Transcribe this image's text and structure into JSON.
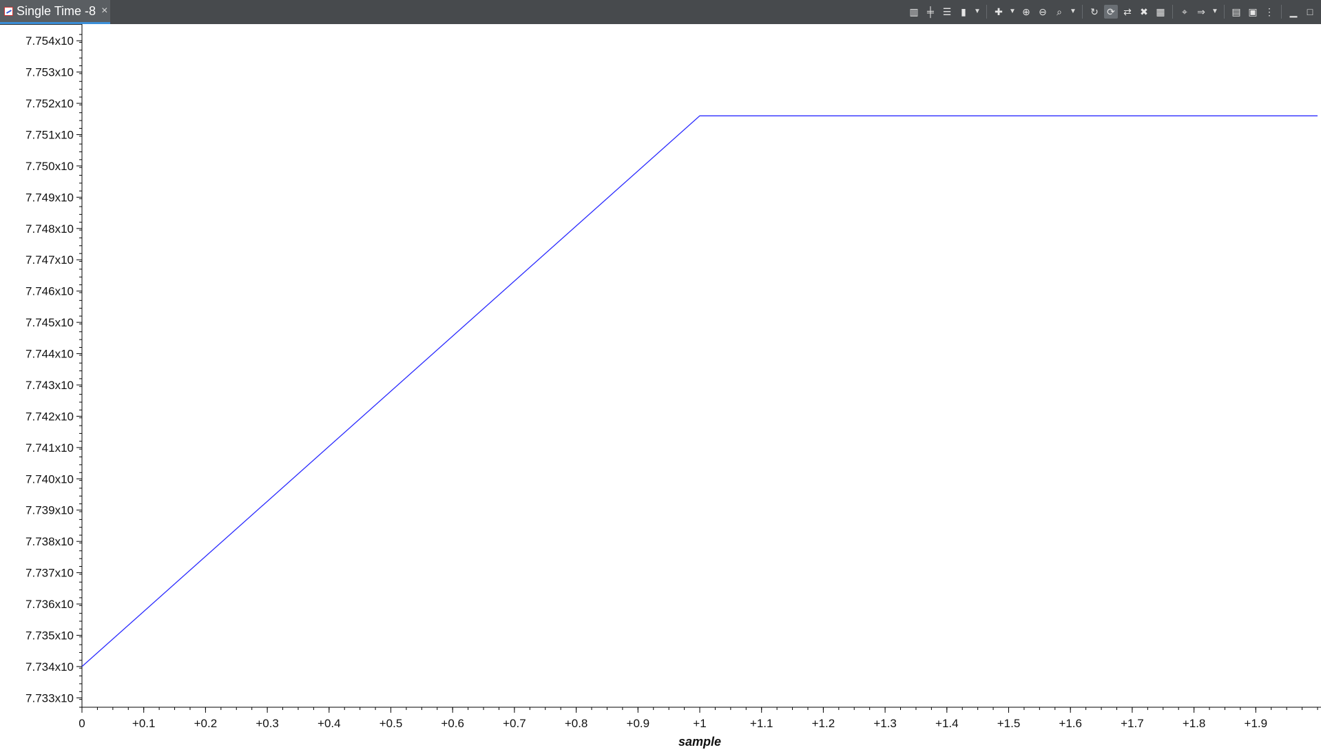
{
  "tab": {
    "title": "Single Time -8",
    "close_symbol": "×"
  },
  "toolbar": {
    "buttons": [
      {
        "name": "view-columns-icon",
        "glyph": "▥"
      },
      {
        "name": "align-center-icon",
        "glyph": "╪"
      },
      {
        "name": "layout-rows-icon",
        "glyph": "☰"
      },
      {
        "name": "color-bars-icon",
        "glyph": "▮"
      },
      {
        "name": "dropdown-1-icon",
        "glyph": "▼",
        "dropdown": true
      },
      {
        "name": "add-graph-icon",
        "glyph": "✚"
      },
      {
        "name": "dropdown-2-icon",
        "glyph": "▼",
        "dropdown": true
      },
      {
        "name": "zoom-in-icon",
        "glyph": "⊕"
      },
      {
        "name": "zoom-out-icon",
        "glyph": "⊖"
      },
      {
        "name": "zoom-fit-icon",
        "glyph": "⌕"
      },
      {
        "name": "dropdown-3-icon",
        "glyph": "▼",
        "dropdown": true
      },
      {
        "name": "refresh-icon",
        "glyph": "↻"
      },
      {
        "name": "continuous-refresh-icon",
        "glyph": "⟳",
        "active": true
      },
      {
        "name": "sync-icon",
        "glyph": "⇄"
      },
      {
        "name": "stop-refresh-icon",
        "glyph": "✖"
      },
      {
        "name": "export-icon",
        "glyph": "▦"
      },
      {
        "name": "cursor-icon",
        "glyph": "⌖"
      },
      {
        "name": "arrow-right-icon",
        "glyph": "⇒"
      },
      {
        "name": "dropdown-4-icon",
        "glyph": "▼",
        "dropdown": true
      },
      {
        "name": "properties-icon",
        "glyph": "▤"
      },
      {
        "name": "panel-icon",
        "glyph": "▣"
      },
      {
        "name": "more-options-icon",
        "glyph": "⋮"
      },
      {
        "name": "minimize-icon",
        "glyph": "▁"
      },
      {
        "name": "maximize-icon",
        "glyph": "□"
      }
    ]
  },
  "colors": {
    "series": "#2a2aff",
    "tabbar": "#474a4d",
    "tab_active": "#5a5e62"
  },
  "chart_data": {
    "type": "line",
    "title": "",
    "xlabel": "sample",
    "ylabel": "",
    "xlim": [
      0,
      2
    ],
    "ylim": [
      7.7327,
      7.7544
    ],
    "x_ticks": [
      0,
      0.1,
      0.2,
      0.3,
      0.4,
      0.5,
      0.6,
      0.7,
      0.8,
      0.9,
      1,
      1.1,
      1.2,
      1.3,
      1.4,
      1.5,
      1.6,
      1.7,
      1.8,
      1.9
    ],
    "x_tick_labels": [
      "0",
      "+0.1",
      "+0.2",
      "+0.3",
      "+0.4",
      "+0.5",
      "+0.6",
      "+0.7",
      "+0.8",
      "+0.9",
      "+1",
      "+1.1",
      "+1.2",
      "+1.3",
      "+1.4",
      "+1.5",
      "+1.6",
      "+1.7",
      "+1.8",
      "+1.9"
    ],
    "y_ticks": [
      7.754,
      7.753,
      7.752,
      7.751,
      7.75,
      7.749,
      7.748,
      7.747,
      7.746,
      7.745,
      7.744,
      7.743,
      7.742,
      7.741,
      7.74,
      7.739,
      7.738,
      7.737,
      7.736,
      7.735,
      7.734,
      7.733
    ],
    "y_tick_labels": [
      "7.754x10",
      "7.753x10",
      "7.752x10",
      "7.751x10",
      "7.750x10",
      "7.749x10",
      "7.748x10",
      "7.747x10",
      "7.746x10",
      "7.745x10",
      "7.744x10",
      "7.743x10",
      "7.742x10",
      "7.741x10",
      "7.740x10",
      "7.739x10",
      "7.738x10",
      "7.737x10",
      "7.736x10",
      "7.735x10",
      "7.734x10",
      "7.733x10"
    ],
    "grid": false,
    "series": [
      {
        "x": [
          0,
          1,
          2
        ],
        "y": [
          7.734,
          7.7516,
          7.7516
        ]
      }
    ]
  }
}
